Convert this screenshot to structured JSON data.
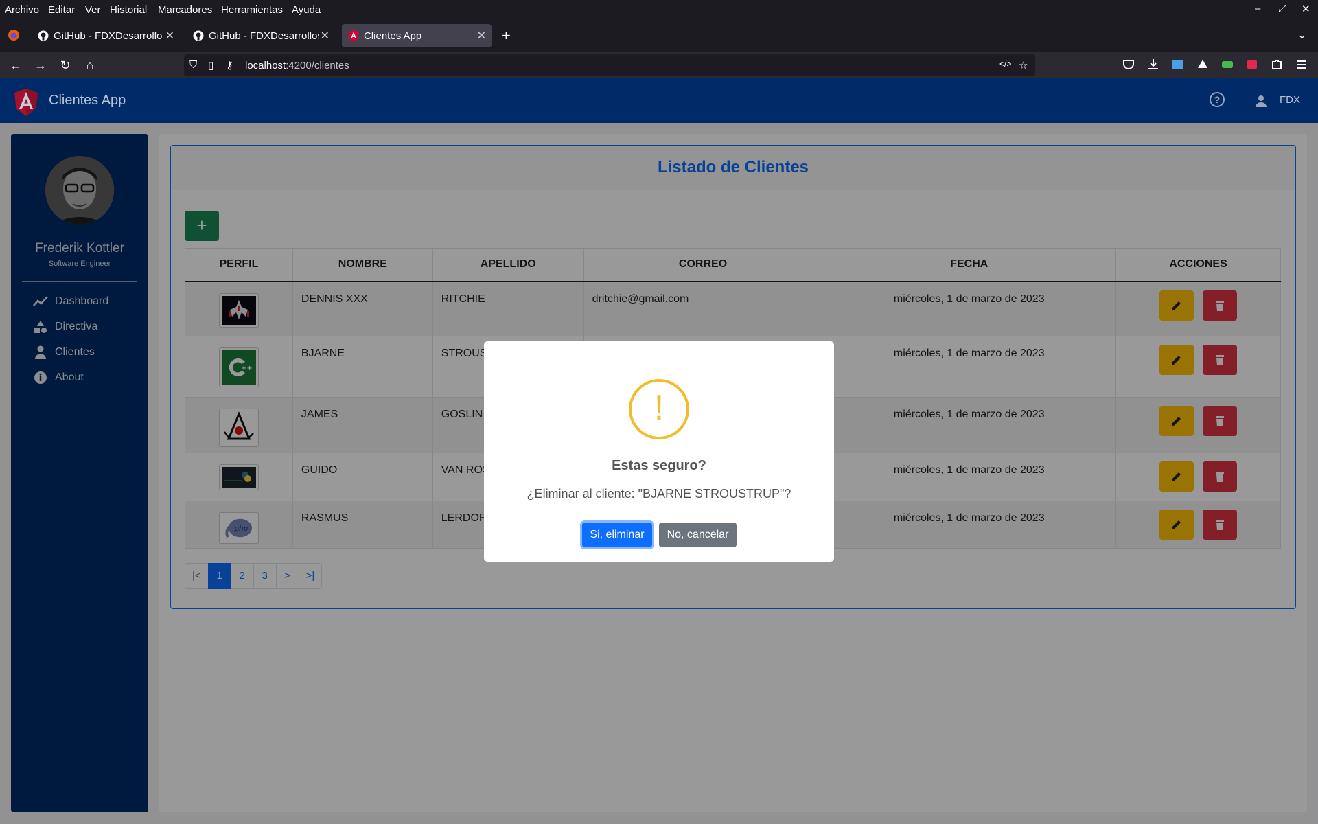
{
  "browser": {
    "menu": [
      "Archivo",
      "Editar",
      "Ver",
      "Historial",
      "Marcadores",
      "Herramientas",
      "Ayuda"
    ],
    "tabs": [
      {
        "title": "GitHub - FDXDesarrollos",
        "active": false
      },
      {
        "title": "GitHub - FDXDesarrollos",
        "active": false
      },
      {
        "title": "Clientes App",
        "active": true
      }
    ],
    "url_host": "localhost",
    "url_path": ":4200/clientes"
  },
  "header": {
    "app_title": "Clientes App",
    "user": "FDX"
  },
  "sidebar": {
    "name": "Frederik Kottler",
    "role": "Software Engineer",
    "items": [
      {
        "label": "Dashboard",
        "icon": "chart-line-icon"
      },
      {
        "label": "Directiva",
        "icon": "shapes-icon"
      },
      {
        "label": "Clientes",
        "icon": "user-icon"
      },
      {
        "label": "About",
        "icon": "info-icon"
      }
    ]
  },
  "main": {
    "title": "Listado de Clientes",
    "add_label": "+",
    "columns": [
      "PERFIL",
      "NOMBRE",
      "APELLIDO",
      "CORREO",
      "FECHA",
      "ACCIONES"
    ],
    "rows": [
      {
        "nombre": "DENNIS XXX",
        "apellido": "RITCHIE",
        "correo": "dritchie@gmail.com",
        "fecha": "miércoles, 1 de marzo de 2023",
        "img": "galaga-icon"
      },
      {
        "nombre": "BJARNE",
        "apellido": "STROUS",
        "correo": "",
        "fecha": "miércoles, 1 de marzo de 2023",
        "img": "cpp-logo"
      },
      {
        "nombre": "JAMES",
        "apellido": "GOSLIN",
        "correo": "",
        "fecha": "miércoles, 1 de marzo de 2023",
        "img": "java-duke-logo"
      },
      {
        "nombre": "GUIDO",
        "apellido": "VAN ROS",
        "correo": "",
        "fecha": "miércoles, 1 de marzo de 2023",
        "img": "python-logo"
      },
      {
        "nombre": "RASMUS",
        "apellido": "LERDOF",
        "correo": "",
        "fecha": "miércoles, 1 de marzo de 2023",
        "img": "php-elephant-logo"
      }
    ],
    "pager": [
      "|<",
      "1",
      "2",
      "3",
      ">",
      ">|"
    ],
    "current_page": "1"
  },
  "modal": {
    "icon": "!",
    "title": "Estas seguro?",
    "text": "¿Eliminar al cliente: \"BJARNE STROUSTRUP\"?",
    "confirm": "Si, eliminar",
    "cancel": "No, cancelar"
  },
  "colors": {
    "brand": "#012a69",
    "primary": "#0d6efd",
    "success": "#198754",
    "warning": "#ffc107",
    "danger": "#dc3545",
    "secondary": "#6c757d"
  }
}
